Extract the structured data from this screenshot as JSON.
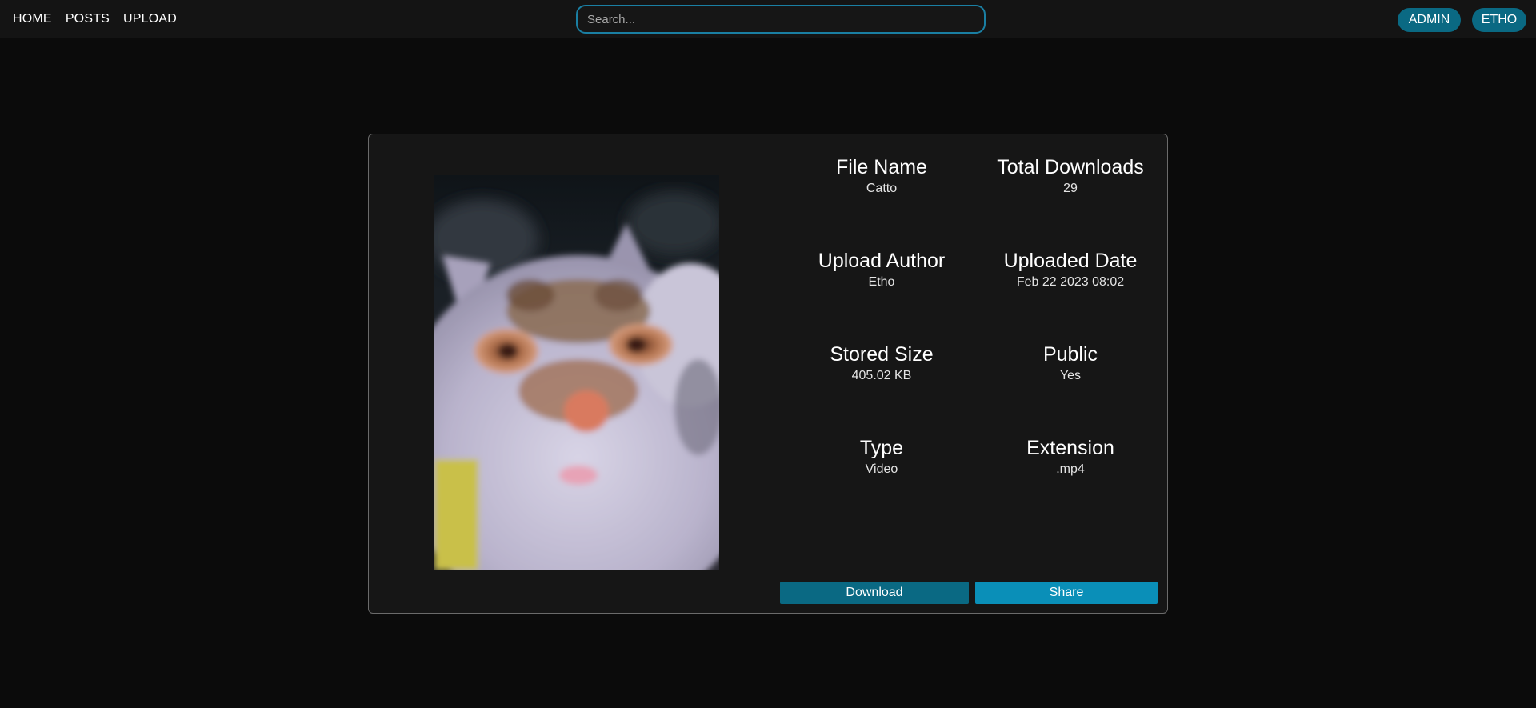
{
  "nav": {
    "links": [
      "HOME",
      "POSTS",
      "UPLOAD"
    ]
  },
  "search": {
    "placeholder": "Search...",
    "value": ""
  },
  "user": {
    "admin_label": "ADMIN",
    "username_label": "ETHO"
  },
  "file": {
    "fields": [
      {
        "title": "File Name",
        "value": "Catto"
      },
      {
        "title": "Total Downloads",
        "value": "29"
      },
      {
        "title": "Upload Author",
        "value": "Etho"
      },
      {
        "title": "Uploaded Date",
        "value": "Feb 22 2023 08:02"
      },
      {
        "title": "Stored Size",
        "value": "405.02 KB"
      },
      {
        "title": "Public",
        "value": "Yes"
      },
      {
        "title": "Type",
        "value": "Video"
      },
      {
        "title": "Extension",
        "value": ".mp4"
      }
    ],
    "preview_icon": "video-thumbnail-cat"
  },
  "actions": {
    "download_label": "Download",
    "share_label": "Share"
  },
  "colors": {
    "background": "#0b0b0b",
    "topbar": "#141414",
    "card": "#161616",
    "accent": "#0a6983",
    "accent_light": "#0a8fb8",
    "search_border": "#1a7fa3"
  }
}
